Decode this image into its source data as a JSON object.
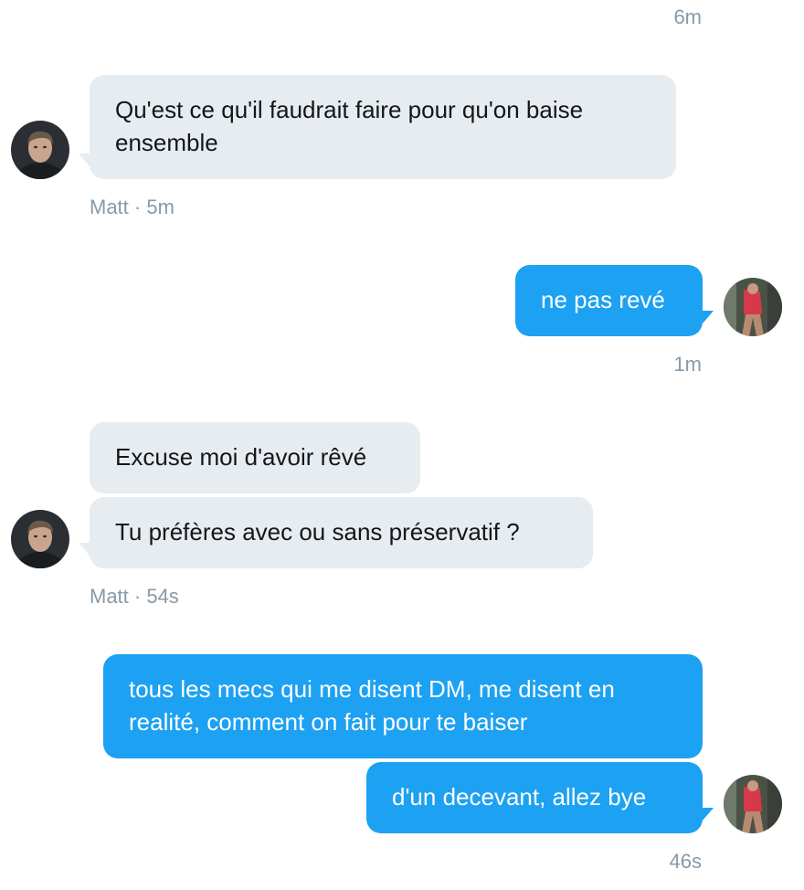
{
  "conversation": {
    "top_timestamp": "6m",
    "groups": [
      {
        "sender": "Matt",
        "direction": "incoming",
        "messages": [
          "Qu'est ce qu'il faudrait faire pour qu'on baise ensemble"
        ],
        "meta": "Matt · 5m"
      },
      {
        "sender": "me",
        "direction": "outgoing",
        "messages": [
          "ne pas revé"
        ],
        "meta": "1m"
      },
      {
        "sender": "Matt",
        "direction": "incoming",
        "messages": [
          "Excuse moi d'avoir rêvé",
          "Tu préfères avec ou sans préservatif ?"
        ],
        "meta": "Matt · 54s"
      },
      {
        "sender": "me",
        "direction": "outgoing",
        "messages": [
          "tous les mecs qui me disent DM, me disent en realité, comment on fait pour te baiser",
          "d'un decevant, allez bye"
        ],
        "meta": "46s"
      }
    ]
  },
  "colors": {
    "incoming_bubble": "#e6ecf0",
    "outgoing_bubble": "#1da1f2",
    "meta_text": "#8899a6"
  },
  "icons": {
    "matt_avatar": "avatar-photo-man",
    "my_avatar": "avatar-photo-woman"
  }
}
